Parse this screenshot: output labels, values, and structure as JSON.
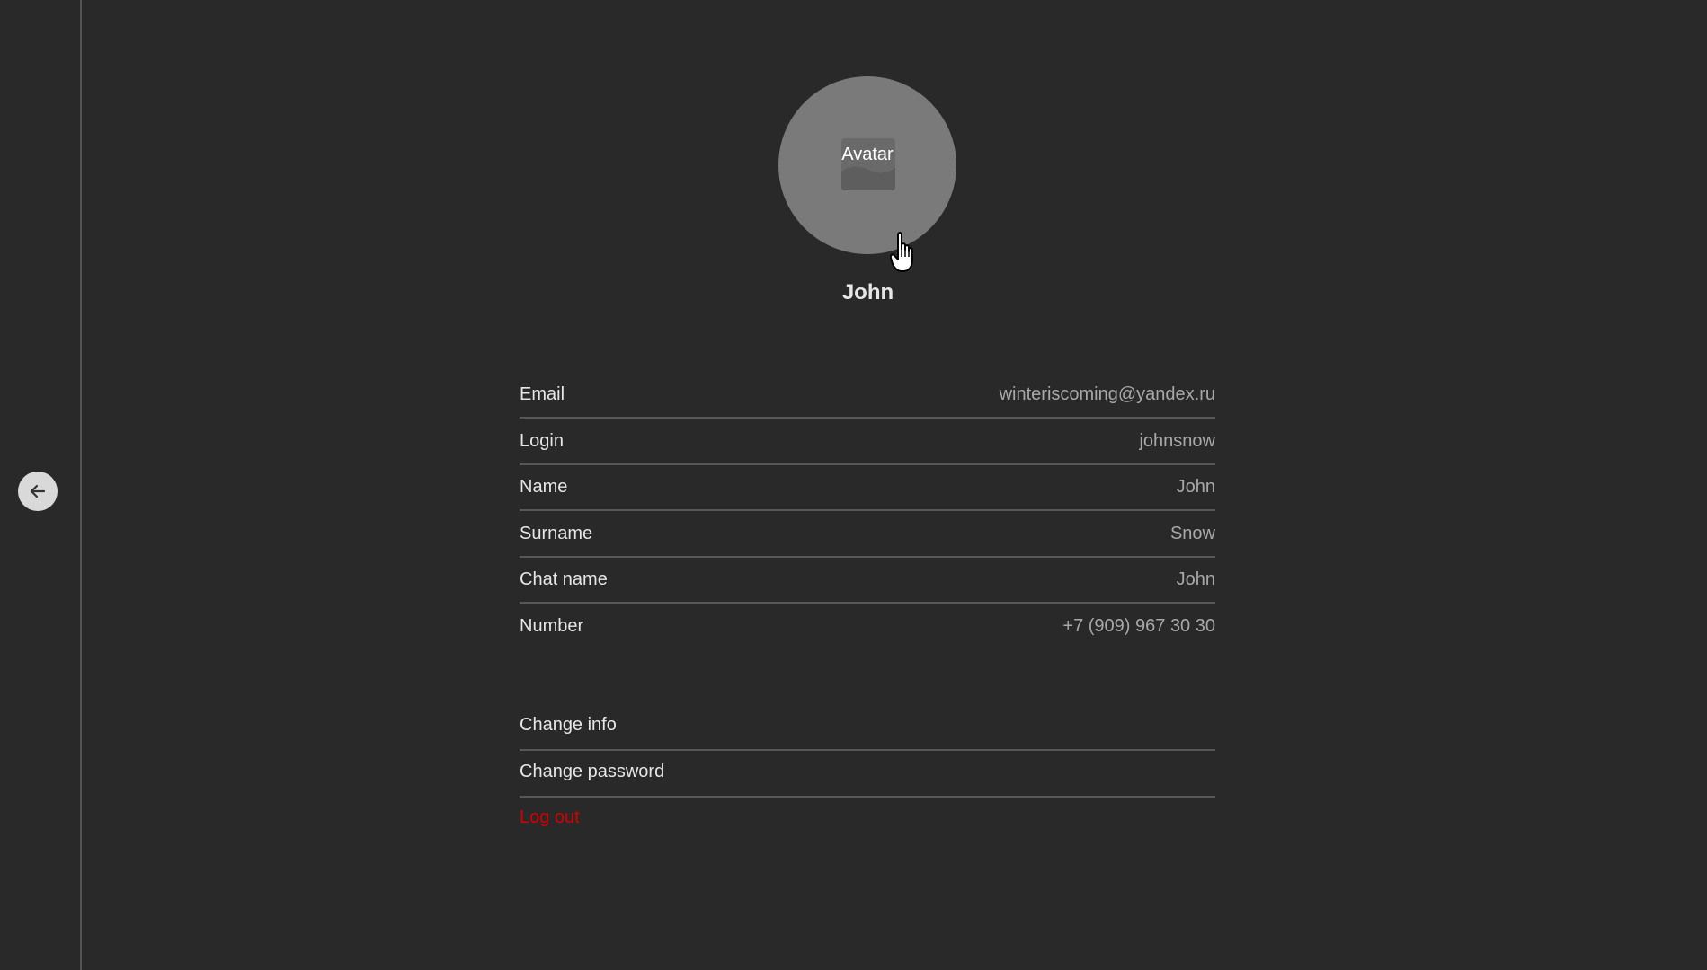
{
  "colors": {
    "background": "#292929",
    "text": "#e6e6e6",
    "muted_value": "#a8a8a8",
    "divider": "#575757",
    "avatar_bg": "#7a7a7a",
    "danger": "#d40000"
  },
  "sidebar": {
    "back_icon": "arrow-left-icon"
  },
  "profile": {
    "avatar_label": "Avatar",
    "avatar_icon": "image-icon",
    "display_name": "John"
  },
  "fields": [
    {
      "label": "Email",
      "value": "winteriscoming@yandex.ru"
    },
    {
      "label": "Login",
      "value": "johnsnow"
    },
    {
      "label": "Name",
      "value": "John"
    },
    {
      "label": "Surname",
      "value": "Snow"
    },
    {
      "label": "Chat name",
      "value": "John"
    },
    {
      "label": "Number",
      "value": "+7 (909) 967 30 30"
    }
  ],
  "actions": {
    "change_info": "Change info",
    "change_password": "Change password",
    "logout": "Log out"
  },
  "cursor_icon": "hand-pointer-icon"
}
